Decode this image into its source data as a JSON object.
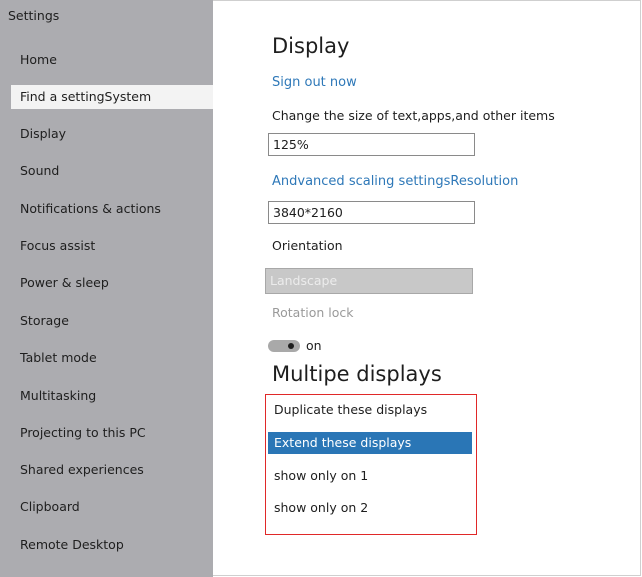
{
  "sidebar": {
    "title": "Settings",
    "items": [
      {
        "label": "Home"
      },
      {
        "label": "Find a settingSystem",
        "selected": true
      },
      {
        "label": "Display"
      },
      {
        "label": "Sound"
      },
      {
        "label": "Notifications & actions"
      },
      {
        "label": "Focus assist"
      },
      {
        "label": "Power & sleep"
      },
      {
        "label": "Storage"
      },
      {
        "label": "Tablet mode"
      },
      {
        "label": "Multitasking"
      },
      {
        "label": "Projecting to this PC"
      },
      {
        "label": "Shared experiences"
      },
      {
        "label": "Clipboard"
      },
      {
        "label": "Remote Desktop"
      }
    ]
  },
  "main": {
    "title": "Display",
    "sign_out_link": "Sign out now",
    "scale_label": "Change the size of text,apps,and other items",
    "scale_value": "125%",
    "advanced_link": "Andvanced scaling settingsResolution",
    "resolution_value": "3840*2160",
    "orientation_label": "Orientation",
    "orientation_value": "Landscape",
    "rotation_lock_label": "Rotation lock",
    "toggle_state": "on",
    "multiple_displays_title": "Multipe displays",
    "display_options": [
      {
        "label": "Duplicate these displays"
      },
      {
        "label": "Extend these displays",
        "selected": true
      },
      {
        "label": "show only on 1"
      },
      {
        "label": "show only on 2"
      }
    ]
  },
  "colors": {
    "sidebar_bg": "#acacb0",
    "accent": "#2a76b6",
    "link": "#2e78b8",
    "highlight_border": "#e02828"
  }
}
